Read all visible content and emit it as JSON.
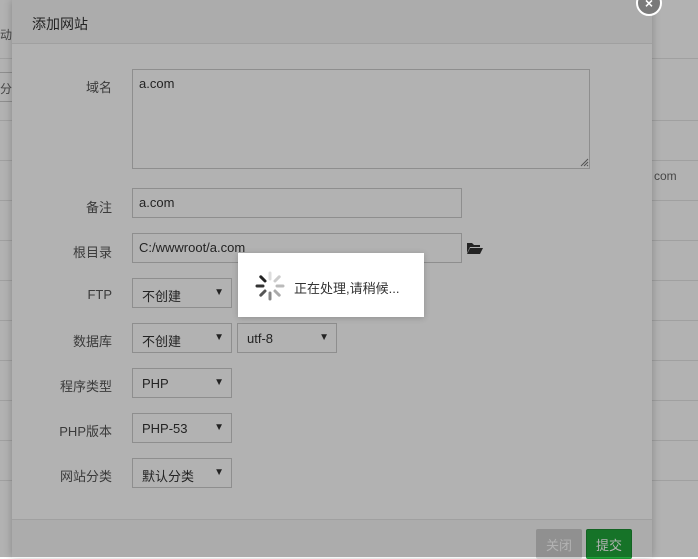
{
  "background": {
    "left_text_1": "动",
    "left_text_2": "分",
    "right_text": "com"
  },
  "dialog": {
    "title": "添加网站",
    "close_glyph": "×",
    "fields": {
      "domain_label": "域名",
      "domain_value": "a.com",
      "remark_label": "备注",
      "remark_value": "a.com",
      "root_label": "根目录",
      "root_value": "C:/wwwroot/a.com",
      "ftp_label": "FTP",
      "ftp_value": "不创建",
      "db_label": "数据库",
      "db_value": "不创建",
      "charset_value": "utf-8",
      "type_label": "程序类型",
      "type_value": "PHP",
      "php_label": "PHP版本",
      "php_value": "PHP-53",
      "category_label": "网站分类",
      "category_value": "默认分类"
    },
    "footer": {
      "close_label": "关闭",
      "submit_label": "提交"
    }
  },
  "loading": {
    "text": "正在处理,请稍候..."
  },
  "colors": {
    "submit": "#20a53a",
    "overlay": "rgba(0,0,0,0.30)"
  }
}
